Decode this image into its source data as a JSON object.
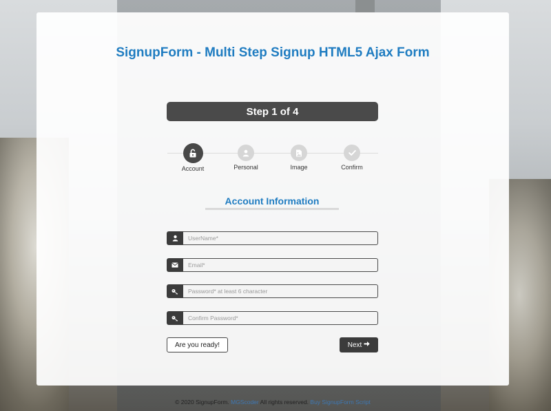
{
  "page": {
    "title": "SignupForm - Multi Step Signup HTML5 Ajax Form"
  },
  "step_indicator": "Step 1 of 4",
  "steps": [
    {
      "label": "Account",
      "icon": "unlock-icon",
      "active": true
    },
    {
      "label": "Personal",
      "icon": "user-icon",
      "active": false
    },
    {
      "label": "Image",
      "icon": "image-icon",
      "active": false
    },
    {
      "label": "Confirm",
      "icon": "check-icon",
      "active": false
    }
  ],
  "section": {
    "title": "Account Information"
  },
  "fields": [
    {
      "name": "username",
      "placeholder": "UserName*",
      "value": "",
      "icon": "user-icon"
    },
    {
      "name": "email",
      "placeholder": "Email*",
      "value": "",
      "icon": "envelope-icon"
    },
    {
      "name": "password",
      "placeholder": "Password* at least 6 character",
      "value": "",
      "icon": "key-icon"
    },
    {
      "name": "confirm_password",
      "placeholder": "Confirm Password*",
      "value": "",
      "icon": "key-icon"
    }
  ],
  "buttons": {
    "ready": "Are you ready!",
    "next": "Next"
  },
  "footer": {
    "copyright": "© 2020 SignupForm.",
    "author_link": "MGScoder",
    "rights": "All rights reserved.",
    "buy_link": "Buy SignupForm Script"
  },
  "colors": {
    "accent": "#1f7cc1",
    "dark": "#484848",
    "step_inactive": "#d6d6d6"
  }
}
